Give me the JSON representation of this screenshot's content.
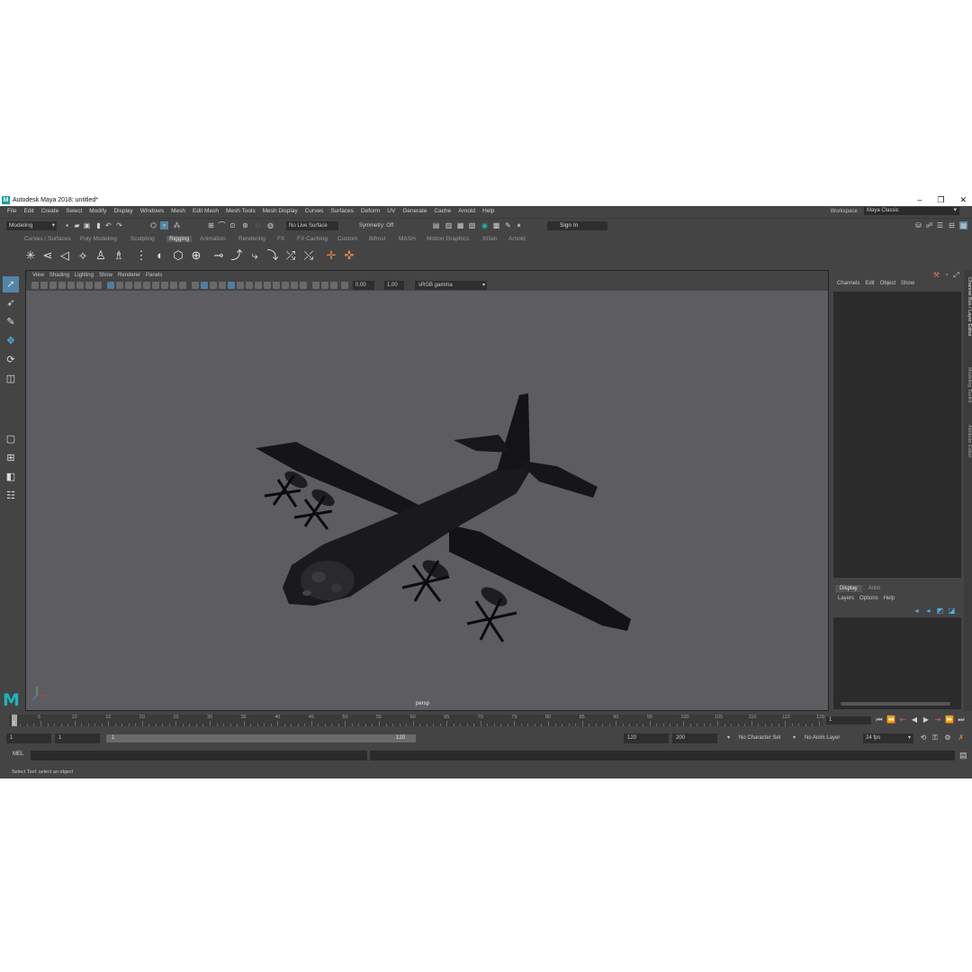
{
  "window": {
    "title": "Autodesk Maya 2018: untitled*"
  },
  "menubar": {
    "items": [
      "File",
      "Edit",
      "Create",
      "Select",
      "Modify",
      "Display",
      "Windows",
      "Mesh",
      "Edit Mesh",
      "Mesh Tools",
      "Mesh Display",
      "Curves",
      "Surfaces",
      "Deform",
      "UV",
      "Generate",
      "Cache",
      "Arnold",
      "Help"
    ],
    "workspace_label": "Workspace :",
    "workspace_value": "Maya Classic"
  },
  "status_line": {
    "menu_set": "Modeling",
    "live_surface": "No Live Surface",
    "symmetry": "Symmetry: Off",
    "sign_in": "Sign In"
  },
  "shelf": {
    "tabs": [
      "Curves / Surfaces",
      "Poly Modeling",
      "Sculpting",
      "Rigging",
      "Animation",
      "Rendering",
      "FX",
      "FX Caching",
      "Custom",
      "Bifrost",
      "MASH",
      "Motion Graphics",
      "XGen",
      "Arnold"
    ],
    "active_tab": "Rigging"
  },
  "viewport": {
    "menu": [
      "View",
      "Shading",
      "Lighting",
      "Show",
      "Renderer",
      "Panels"
    ],
    "exposure": "0.00",
    "gamma": "1.00",
    "color_space": "sRGB gamma",
    "camera_label": "persp"
  },
  "channel_box": {
    "menu": [
      "Channels",
      "Edit",
      "Object",
      "Show"
    ]
  },
  "layer_editor": {
    "tabs": [
      "Display",
      "Anim"
    ],
    "active_tab": "Display",
    "menu": [
      "Layers",
      "Options",
      "Help"
    ]
  },
  "side_tabs": [
    "Channel Box / Layer Editor",
    "Modeling Toolkit",
    "Attribute Editor"
  ],
  "timeline": {
    "ticks": [
      "5",
      "10",
      "15",
      "20",
      "25",
      "30",
      "35",
      "40",
      "45",
      "50",
      "55",
      "60",
      "65",
      "70",
      "75",
      "80",
      "85",
      "90",
      "95",
      "100",
      "105",
      "110",
      "115",
      "120"
    ],
    "current_frame_marker": "1",
    "current_frame": "1"
  },
  "range_slider": {
    "start_time": "1",
    "playback_start": "1",
    "slider_start": "1",
    "slider_end": "120",
    "playback_end": "120",
    "end_time": "200",
    "character_set": "No Character Set",
    "anim_layer": "No Anim Layer",
    "fps": "24 fps"
  },
  "command_line": {
    "label": "MEL"
  },
  "help_line": {
    "text": "Select Tool: select an object"
  },
  "colors": {
    "ui_bg": "#444444",
    "field_bg": "#2b2b2b",
    "viewport_bg": "#5c5c61",
    "accent": "#5285a6",
    "maya_teal": "#1fb5b8"
  }
}
